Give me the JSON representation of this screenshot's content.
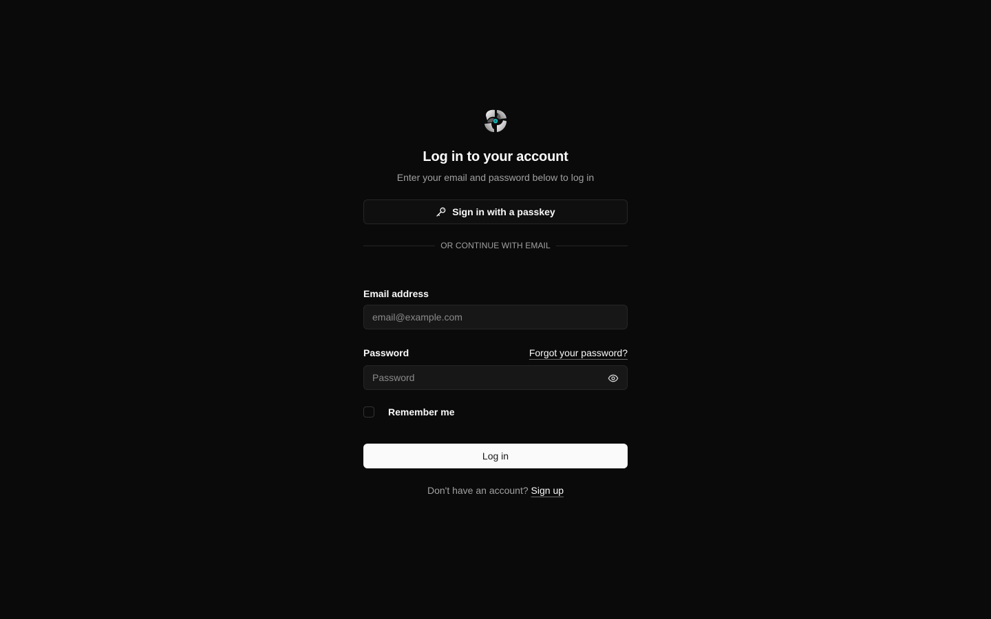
{
  "header": {
    "logo_icon": "app-logo-icon",
    "title": "Log in to your account",
    "subtitle": "Enter your email and password below to log in"
  },
  "passkey": {
    "icon": "key-icon",
    "label": "Sign in with a passkey"
  },
  "divider": {
    "text": "OR CONTINUE WITH EMAIL"
  },
  "email": {
    "label": "Email address",
    "value": "",
    "placeholder": "email@example.com"
  },
  "password": {
    "label": "Password",
    "forgot_label": "Forgot your password?",
    "value": "",
    "placeholder": "Password",
    "toggle_icon": "eye-icon"
  },
  "remember": {
    "label": "Remember me",
    "checked": false
  },
  "login": {
    "label": "Log in"
  },
  "signup": {
    "prompt": "Don't have an account? ",
    "link_label": "Sign up"
  },
  "colors": {
    "background": "#0a0a0a",
    "primary_button": "#fafafa",
    "border": "#262626",
    "muted_text": "#a1a1a1"
  }
}
